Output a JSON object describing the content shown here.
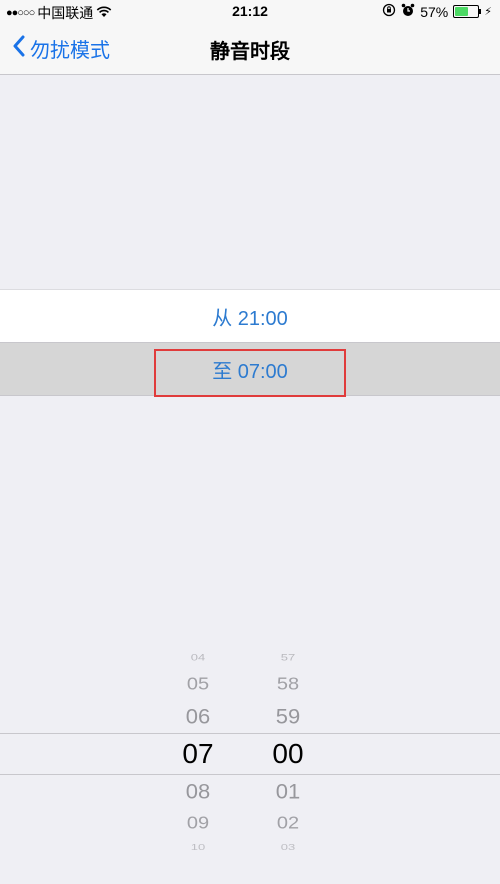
{
  "status_bar": {
    "signal": "●●○○○",
    "carrier": "中国联通",
    "time": "21:12",
    "battery": "57%",
    "battery_level": 0.57
  },
  "nav": {
    "back_label": "勿扰模式",
    "title": "静音时段"
  },
  "schedule": {
    "from_label": "从 21:00",
    "to_label": "至 07:00"
  },
  "picker": {
    "hours": [
      "04",
      "05",
      "06",
      "07",
      "08",
      "09",
      "10"
    ],
    "minutes": [
      "57",
      "58",
      "59",
      "00",
      "01",
      "02",
      "03"
    ],
    "selected_hour": "07",
    "selected_minute": "00"
  }
}
